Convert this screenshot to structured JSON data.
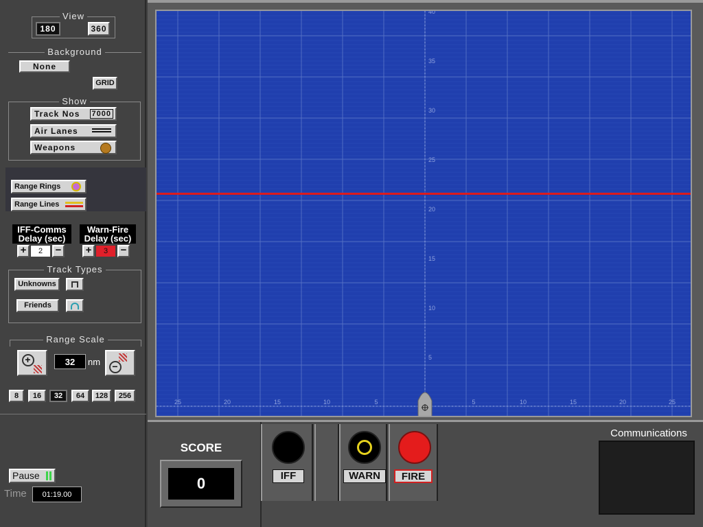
{
  "view": {
    "title": "View",
    "buttons": [
      {
        "label": "180",
        "active": true
      },
      {
        "label": "360",
        "active": false
      }
    ]
  },
  "background": {
    "title": "Background",
    "none_label": "None",
    "grid_label": "GRID"
  },
  "show": {
    "title": "Show",
    "track_nos_label": "Track Nos",
    "track_nos_value": "7000",
    "air_lanes_label": "Air Lanes",
    "weapons_label": "Weapons"
  },
  "range": {
    "rings_label": "Range Rings",
    "lines_label": "Range Lines"
  },
  "delays": {
    "iff_comms_label_1": "IFF-Comms",
    "iff_comms_label_2": "Delay (sec)",
    "iff_comms_value": "2",
    "warn_fire_label_1": "Warn-Fire",
    "warn_fire_label_2": "Delay (sec)",
    "warn_fire_value": "3"
  },
  "track_types": {
    "title": "Track Types",
    "unknowns_label": "Unknowns",
    "friends_label": "Friends"
  },
  "range_scale": {
    "title": "Range Scale",
    "value": "32",
    "unit": "nm",
    "options": [
      "8",
      "16",
      "32",
      "64",
      "128",
      "256"
    ],
    "selected": "32"
  },
  "controls": {
    "pause_label": "Pause",
    "time_label": "Time",
    "time_value": "01:19.00"
  },
  "radar": {
    "range_ticks": [
      "40",
      "35",
      "30",
      "25",
      "20",
      "15",
      "10",
      "5"
    ],
    "bearing_ticks": [
      "25",
      "20",
      "15",
      "10",
      "5",
      "5",
      "10",
      "15",
      "20",
      "25"
    ],
    "range_line_nm": 21.5,
    "max_range_nm": 40,
    "colors": {
      "sea": "#203fae",
      "grid": "#5a74c6",
      "range_line": "#e01a1a"
    }
  },
  "score": {
    "title": "SCORE",
    "value": "0"
  },
  "actions": {
    "iff_label": "IFF",
    "warn_label": "WARN",
    "fire_label": "FIRE"
  },
  "comms": {
    "title": "Communications"
  }
}
